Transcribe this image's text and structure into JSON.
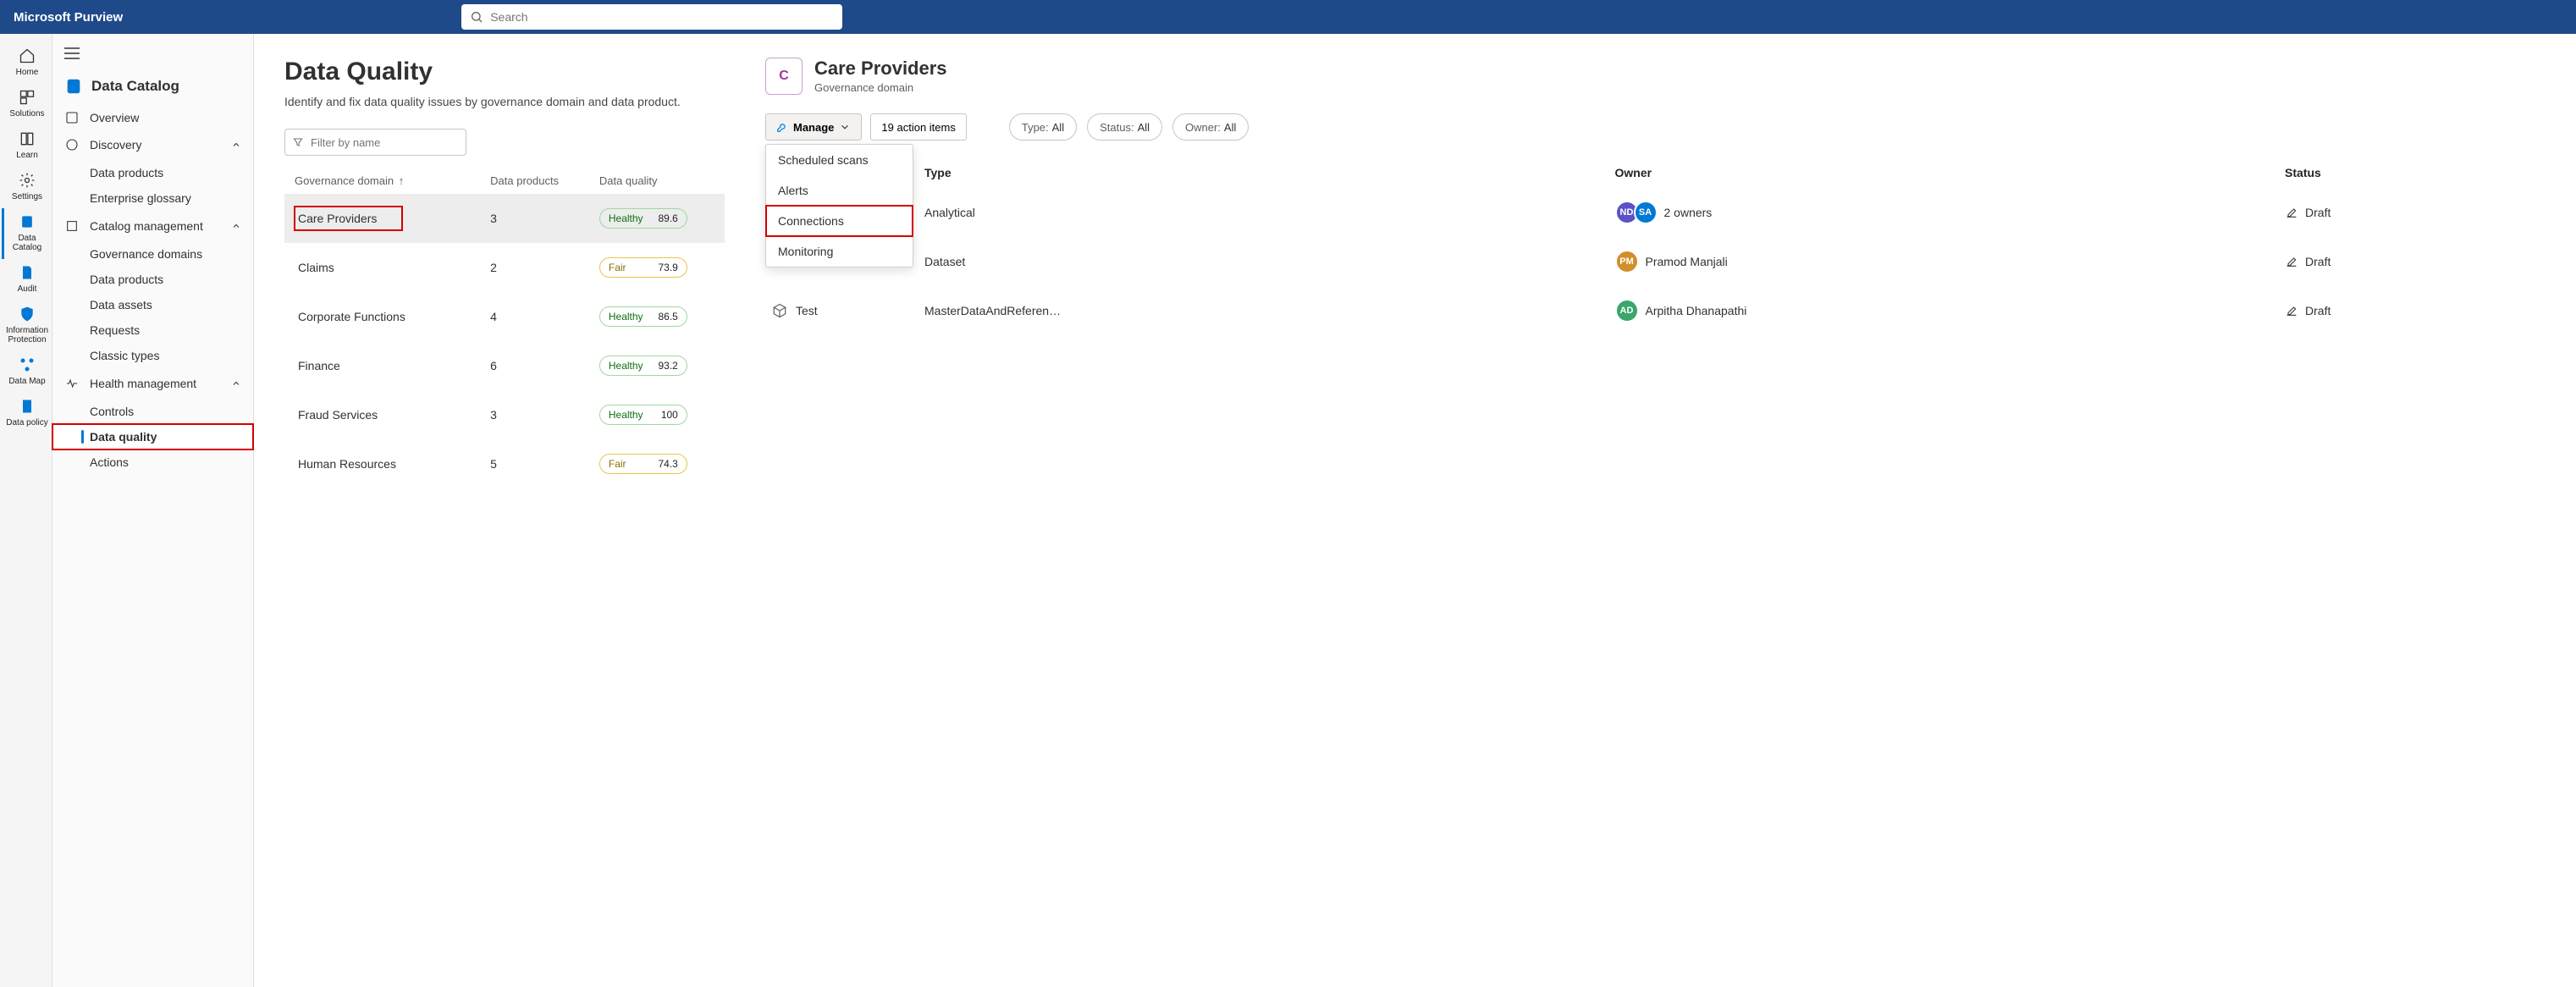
{
  "brand": "Microsoft Purview",
  "search_placeholder": "Search",
  "rail": [
    {
      "label": "Home"
    },
    {
      "label": "Solutions"
    },
    {
      "label": "Learn"
    },
    {
      "label": "Settings"
    },
    {
      "label": "Data Catalog"
    },
    {
      "label": "Audit"
    },
    {
      "label": "Information Protection"
    },
    {
      "label": "Data Map"
    },
    {
      "label": "Data policy"
    }
  ],
  "catalog_title": "Data Catalog",
  "nav": {
    "overview": "Overview",
    "discovery": {
      "label": "Discovery",
      "items": [
        "Data products",
        "Enterprise glossary"
      ]
    },
    "catalog_mgmt": {
      "label": "Catalog management",
      "items": [
        "Governance domains",
        "Data products",
        "Data assets",
        "Requests",
        "Classic types"
      ]
    },
    "health": {
      "label": "Health management",
      "items": [
        "Controls",
        "Data quality",
        "Actions"
      ]
    }
  },
  "page": {
    "title": "Data Quality",
    "subtitle": "Identify and fix data quality issues by governance domain and data product.",
    "filter_placeholder": "Filter by name",
    "columns": {
      "gov": "Governance domain",
      "products": "Data products",
      "quality": "Data quality"
    },
    "rows": [
      {
        "name": "Care Providers",
        "products": "3",
        "quality": "Healthy",
        "score": "89.6",
        "selected": true,
        "hl": true
      },
      {
        "name": "Claims",
        "products": "2",
        "quality": "Fair",
        "score": "73.9"
      },
      {
        "name": "Corporate Functions",
        "products": "4",
        "quality": "Healthy",
        "score": "86.5"
      },
      {
        "name": "Finance",
        "products": "6",
        "quality": "Healthy",
        "score": "93.2"
      },
      {
        "name": "Fraud Services",
        "products": "3",
        "quality": "Healthy",
        "score": "100"
      },
      {
        "name": "Human Resources",
        "products": "5",
        "quality": "Fair",
        "score": "74.3"
      }
    ]
  },
  "detail": {
    "initial": "C",
    "title": "Care Providers",
    "subtitle": "Governance domain",
    "manage_label": "Manage",
    "actions_label": "19 action items",
    "chips": {
      "type_k": "Type:",
      "type_v": " All",
      "status_k": "Status:",
      "status_v": " All",
      "owner_k": "Owner:",
      "owner_v": " All"
    },
    "menu": [
      "Scheduled scans",
      "Alerts",
      "Connections",
      "Monitoring"
    ],
    "columns": {
      "type": "Type",
      "owner": "Owner",
      "status": "Status"
    },
    "rows": [
      {
        "type": "Analytical",
        "owner_label": "2 owners",
        "avatars": [
          {
            "t": "ND",
            "c": "#5a52c6"
          },
          {
            "t": "SA",
            "c": "#0078d4"
          }
        ],
        "status": "Draft"
      },
      {
        "type": "Dataset",
        "owner_label": "Pramod Manjali",
        "avatars": [
          {
            "t": "PM",
            "c": "#d18f2a"
          }
        ],
        "status": "Draft"
      },
      {
        "name": "Test",
        "type": "MasterDataAndReferen…",
        "owner_label": "Arpitha Dhanapathi",
        "avatars": [
          {
            "t": "AD",
            "c": "#3aa66a"
          }
        ],
        "status": "Draft"
      }
    ]
  }
}
